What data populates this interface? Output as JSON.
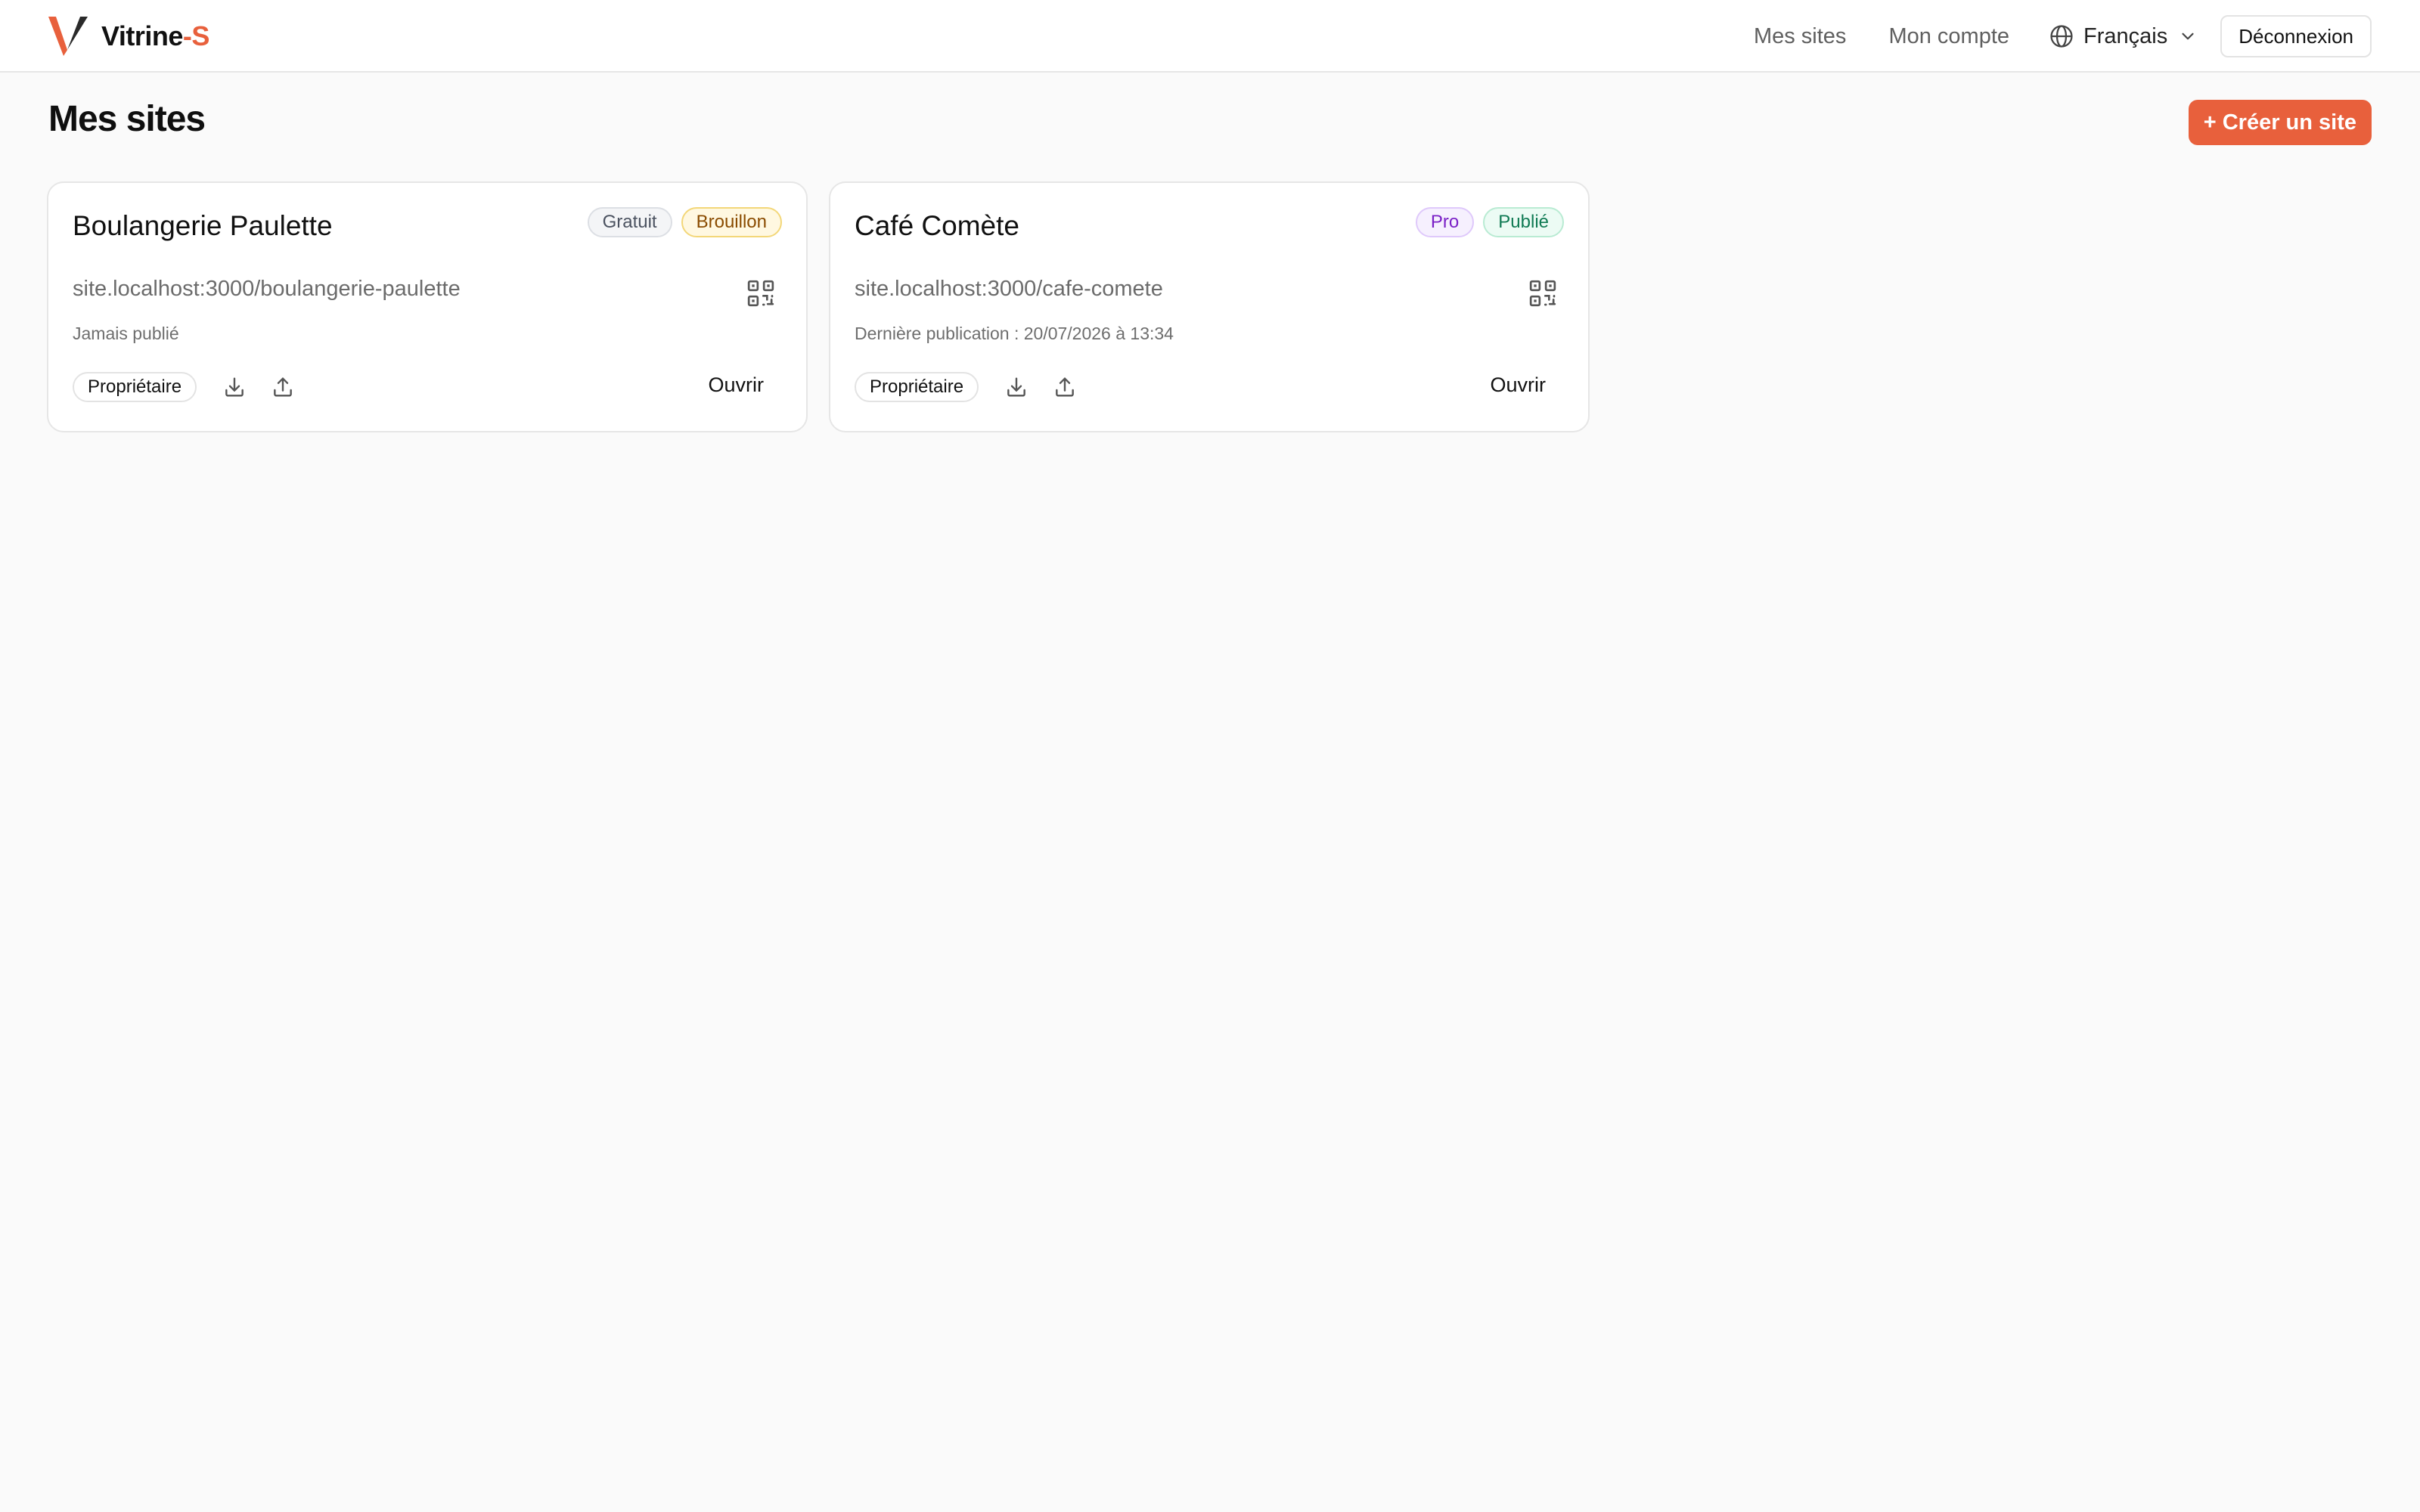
{
  "brand": {
    "name": "Vitrine",
    "dash": "-",
    "accent": "S",
    "accent_color": "#e8603c"
  },
  "nav": {
    "mes_sites": "Mes sites",
    "mon_compte": "Mon compte",
    "language": "Français",
    "logout": "Déconnexion"
  },
  "page": {
    "title": "Mes sites",
    "create_button": "+ Créer un site"
  },
  "sites": [
    {
      "name": "Boulangerie Paulette",
      "plan": "Gratuit",
      "status": "Brouillon",
      "url": "site.localhost:3000/boulangerie-paulette",
      "publication": "Jamais publié",
      "role": "Propriétaire",
      "open": "Ouvrir"
    },
    {
      "name": "Café Comète",
      "plan": "Pro",
      "status": "Publié",
      "url": "site.localhost:3000/cafe-comete",
      "publication": "Dernière publication : 20/07/2026 à 13:34",
      "role": "Propriétaire",
      "open": "Ouvrir"
    }
  ],
  "icons": {
    "logo": "v-logo-icon",
    "language": "globe-icon",
    "dropdown": "chevron-down-icon",
    "qr": "qr-code-icon",
    "download": "download-icon",
    "upload": "upload-icon"
  }
}
